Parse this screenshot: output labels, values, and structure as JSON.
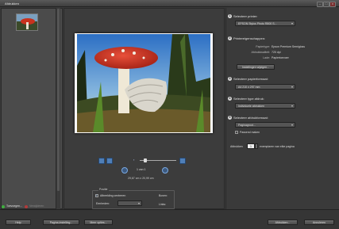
{
  "window": {
    "title": "Afdrukken",
    "min": "–",
    "max": "□",
    "close": "x"
  },
  "steps": [
    {
      "num": "1",
      "label": "Selecteer printer:",
      "value": "EPSON Stylus Photo R800 S..."
    },
    {
      "num": "2",
      "label": "Printereigenschappen:",
      "props": [
        {
          "k": "Papiertype:",
          "v": "Epson Premium Semigloss"
        },
        {
          "k": "Afdrukkwaliteit:",
          "v": "720 dpi"
        },
        {
          "k": "Lade:",
          "v": "Papiertoevoer"
        }
      ],
      "button": "Instellingen wijzigen..."
    },
    {
      "num": "3",
      "label": "Selecteer papierformaat:",
      "value": "A4 210 x 297 mm"
    },
    {
      "num": "4",
      "label": "Selecteer type afdruk:",
      "value": "Individuele afdrukken"
    },
    {
      "num": "5",
      "label": "Selecteer afdrukformaat:",
      "value": "Paginagroot...",
      "check": "Passend maken"
    }
  ],
  "copies": {
    "prefix": "Afdrukken",
    "value": "1",
    "suffix": "exemplaren van elke pagina"
  },
  "preview": {
    "page": "1 van 1",
    "size": "29,67 cm x 20,99 cm"
  },
  "crop": {
    "title": "Positie",
    "check": "Afbeelding centreren",
    "unit_label": "Eenheden:",
    "unit_value": "",
    "right_top": "Boven:",
    "right_bottom": "Links:"
  },
  "left": {
    "add_button": "Toevoegen...",
    "remove_button": "Verwijderen"
  },
  "footer": {
    "help": "Help",
    "page_setup": "Pagina-instelling...",
    "more_options": "Meer opties...",
    "print": "Afdrukken...",
    "cancel": "Annuleren"
  },
  "colors": {
    "accent": "#4f7fb8",
    "add_icon": "#3fae3f",
    "remove_icon": "#b23a3a"
  }
}
